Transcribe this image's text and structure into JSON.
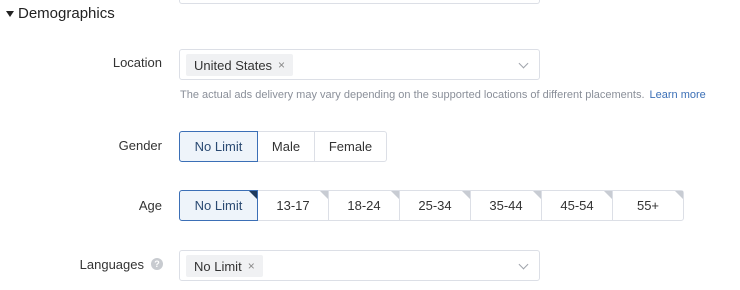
{
  "section": {
    "title": "Demographics"
  },
  "location": {
    "label": "Location",
    "tag": "United States",
    "tag_close": "×",
    "hint": "The actual ads delivery may vary depending on the supported locations of different placements.",
    "hint_link": "Learn more"
  },
  "gender": {
    "label": "Gender",
    "options": [
      "No Limit",
      "Male",
      "Female"
    ],
    "selected": "No Limit"
  },
  "age": {
    "label": "Age",
    "options": [
      "No Limit",
      "13-17",
      "18-24",
      "25-34",
      "35-44",
      "45-54",
      "55+"
    ],
    "selected": "No Limit"
  },
  "languages": {
    "label": "Languages",
    "help_icon": "?",
    "tag": "No Limit",
    "tag_close": "×"
  },
  "colors": {
    "accent": "#3b6fb6",
    "selected_bg": "#eef4fa",
    "border": "#dcdfe6",
    "hint": "#8a8f99"
  }
}
